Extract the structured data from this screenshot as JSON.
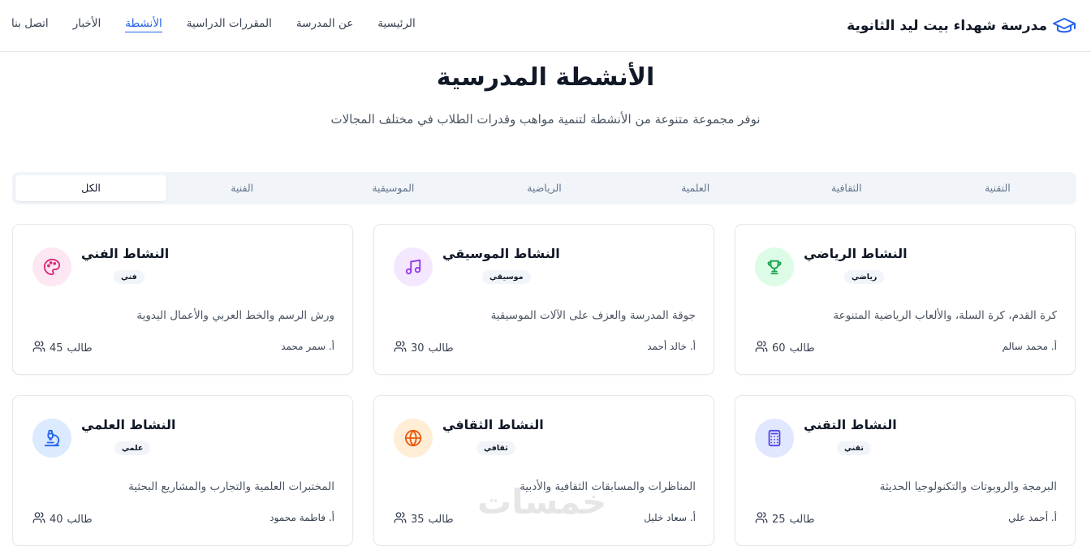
{
  "brand": {
    "name": "مدرسة شهداء بيت ليد الثانوية",
    "icon": "graduation-cap-icon",
    "color": "#2563eb"
  },
  "nav": {
    "links": [
      {
        "label": "الرئيسية"
      },
      {
        "label": "عن المدرسة"
      },
      {
        "label": "المقررات الدراسية"
      },
      {
        "label": "الأنشطة",
        "active": true
      },
      {
        "label": "الأخبار"
      },
      {
        "label": "اتصل بنا"
      }
    ]
  },
  "hero": {
    "title": "الأنشطة المدرسية",
    "subtitle": "نوفر مجموعة متنوعة من الأنشطة لتنمية مواهب وقدرات الطلاب في مختلف المجالات"
  },
  "tabs": [
    {
      "label": "التقنية"
    },
    {
      "label": "الثقافية"
    },
    {
      "label": "العلمية"
    },
    {
      "label": "الرياضية"
    },
    {
      "label": "الموسيقية"
    },
    {
      "label": "الفنية"
    },
    {
      "label": "الكل",
      "active": true
    }
  ],
  "cards": [
    {
      "title": "النشاط الرياضي",
      "badge": "رياضي",
      "desc": "كرة القدم، كرة السلة، والألعاب الرياضية المتنوعة",
      "teacher": "أ. محمد سالم",
      "count": "60",
      "students_label": "طالب",
      "icon": "trophy-icon",
      "icon_color": "#16a34a",
      "icon_bg": "#dcfce7"
    },
    {
      "title": "النشاط الموسيقي",
      "badge": "موسيقي",
      "desc": "جوقة المدرسة والعزف على الآلات الموسيقية",
      "teacher": "أ. خالد أحمد",
      "count": "30",
      "students_label": "طالب",
      "icon": "music-icon",
      "icon_color": "#9333ea",
      "icon_bg": "#f3e8ff"
    },
    {
      "title": "النشاط الفني",
      "badge": "فني",
      "desc": "ورش الرسم والخط العربي والأعمال اليدوية",
      "teacher": "أ. سمر محمد",
      "count": "45",
      "students_label": "طالب",
      "icon": "palette-icon",
      "icon_color": "#db2777",
      "icon_bg": "#fce7f3"
    },
    {
      "title": "النشاط التقني",
      "badge": "تقني",
      "desc": "البرمجة والروبوتات والتكنولوجيا الحديثة",
      "teacher": "أ. أحمد علي",
      "count": "25",
      "students_label": "طالب",
      "icon": "calculator-icon",
      "icon_color": "#4f46e5",
      "icon_bg": "#e0e7ff"
    },
    {
      "title": "النشاط الثقافي",
      "badge": "ثقافي",
      "desc": "المناظرات والمسابقات الثقافية والأدبية",
      "teacher": "أ. سعاد خليل",
      "count": "35",
      "students_label": "طالب",
      "icon": "globe-icon",
      "icon_color": "#ea580c",
      "icon_bg": "#ffedd5"
    },
    {
      "title": "النشاط العلمي",
      "badge": "علمي",
      "desc": "المختبرات العلمية والتجارب والمشاريع البحثية",
      "teacher": "أ. فاطمة محمود",
      "count": "40",
      "students_label": "طالب",
      "icon": "microscope-icon",
      "icon_color": "#2563eb",
      "icon_bg": "#dbeafe"
    }
  ],
  "watermark": "خمسات"
}
